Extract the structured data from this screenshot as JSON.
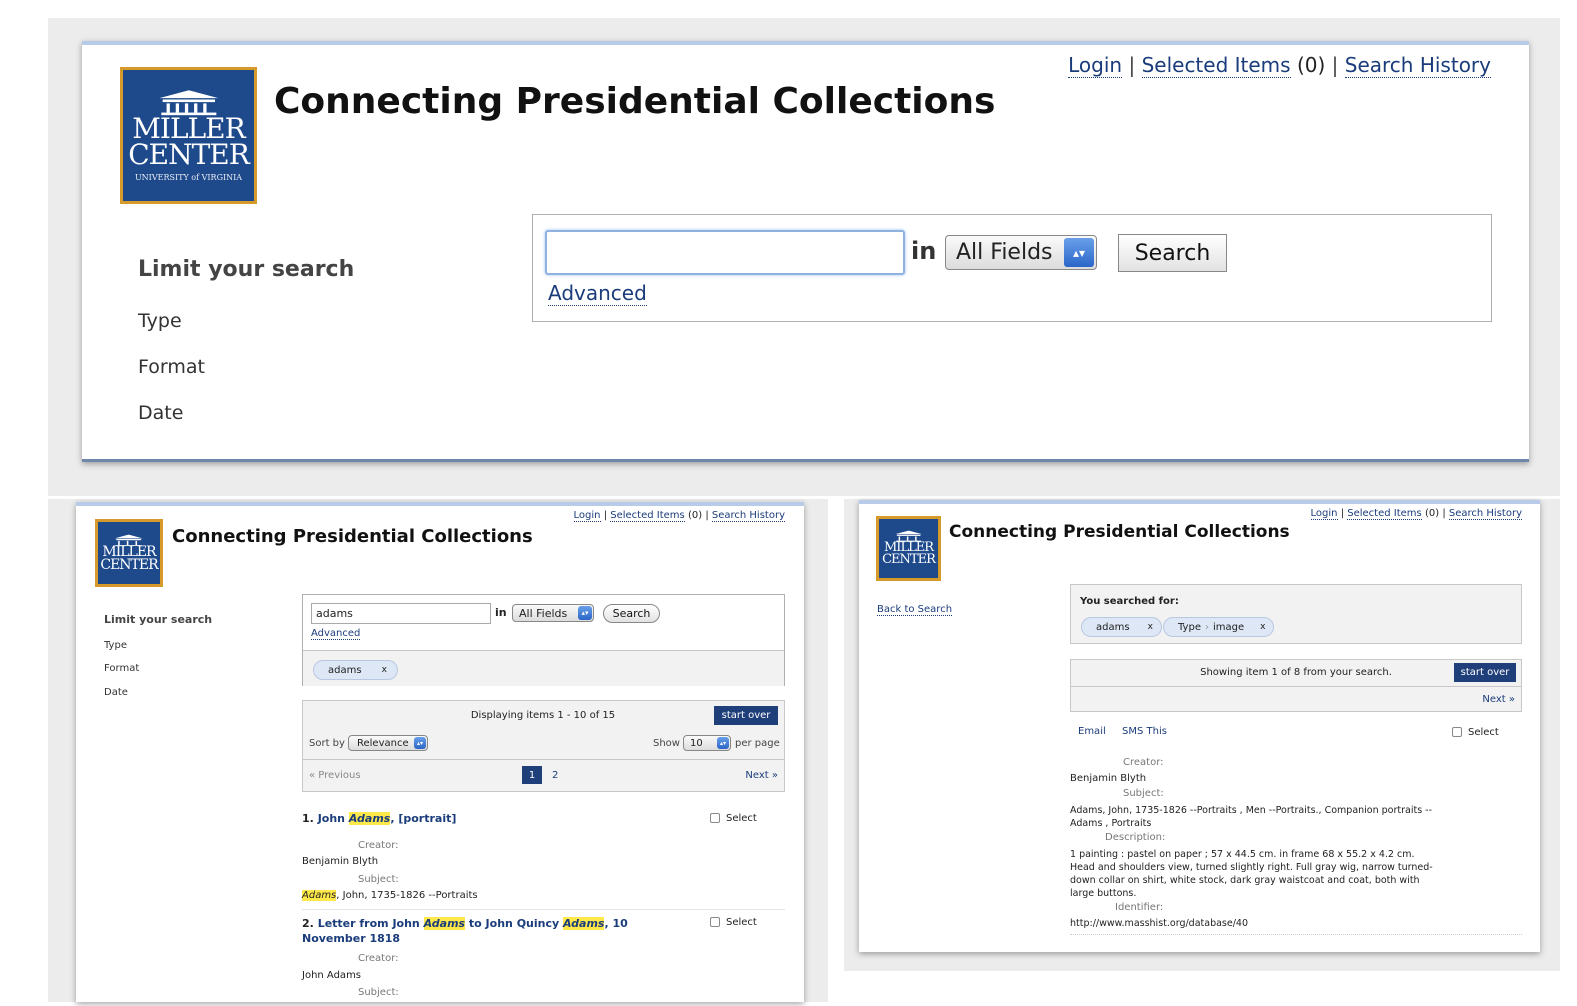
{
  "site": {
    "title": "Connecting Presidential Collections",
    "logo_line1": "MILLER",
    "logo_line2": "CENTER",
    "logo_sub": "UNIVERSITY of VIRGINIA"
  },
  "util": {
    "login": "Login",
    "selected_items": "Selected Items",
    "selected_count": "(0)",
    "search_history": "Search History",
    "separator": "|"
  },
  "sidebar": {
    "heading": "Limit your search",
    "facets": [
      "Type",
      "Format",
      "Date"
    ]
  },
  "search": {
    "in_label": "in",
    "field_select": "All Fields",
    "button": "Search",
    "advanced": "Advanced",
    "query_empty": "",
    "query_results": "adams"
  },
  "results": {
    "constraint": "adams",
    "chip_remove": "x",
    "displaying": "Displaying items 1 - 10 of 15",
    "start_over": "start over",
    "sort_by": "Sort by",
    "sort_value": "Relevance",
    "show": "Show",
    "per_page_value": "10",
    "per_page": "per page",
    "previous": "« Previous",
    "pages": [
      "1",
      "2"
    ],
    "next": "Next »",
    "select": "Select",
    "items": [
      {
        "num": "1.",
        "title_pre": "John ",
        "title_hl": "Adams",
        "title_post": ", [portrait]",
        "creator_label": "Creator:",
        "creator": "Benjamin Blyth",
        "subject_label": "Subject:",
        "subject_hl": "Adams",
        "subject_post": ", John, 1735-1826 --Portraits"
      },
      {
        "num": "2.",
        "title_pre": "Letter from John ",
        "title_hl": "Adams",
        "title_mid": " to John Quincy ",
        "title_hl2": "Adams",
        "title_post": ", 10 November 1818",
        "creator_label": "Creator:",
        "creator": "John Adams",
        "subject_label": "Subject:"
      }
    ]
  },
  "detail": {
    "back": "Back to Search",
    "you_searched": "You searched for:",
    "chip1": "adams",
    "chip2_field": "Type",
    "chip2_sep": "›",
    "chip2_value": "image",
    "chip_remove": "x",
    "showing": "Showing item 1 of 8 from your search.",
    "start_over": "start over",
    "next": "Next »",
    "email": "Email",
    "sms": "SMS This",
    "select": "Select",
    "creator_label": "Creator:",
    "creator": "Benjamin Blyth",
    "subject_label": "Subject:",
    "subject": "Adams, John, 1735-1826 --Portraits , Men --Portraits., Companion portraits --Adams , Portraits",
    "description_label": "Description:",
    "description": "1 painting : pastel on paper ; 57 x 44.5 cm. in frame 68 x 55.2 x 4.2 cm. Head and shoulders view, turned slightly right. Full gray wig, narrow turned-down collar on shirt, white stock, dark gray waistcoat and coat, both with large buttons.",
    "identifier_label": "Identifier:",
    "identifier": "http://www.masshist.org/database/40"
  },
  "colors": {
    "logo_bg": "#1e4a8c",
    "logo_border": "#d69a2a",
    "link": "#1a3c7a",
    "start_over_bg": "#1f3f7a",
    "highlight": "#ffe94a"
  }
}
